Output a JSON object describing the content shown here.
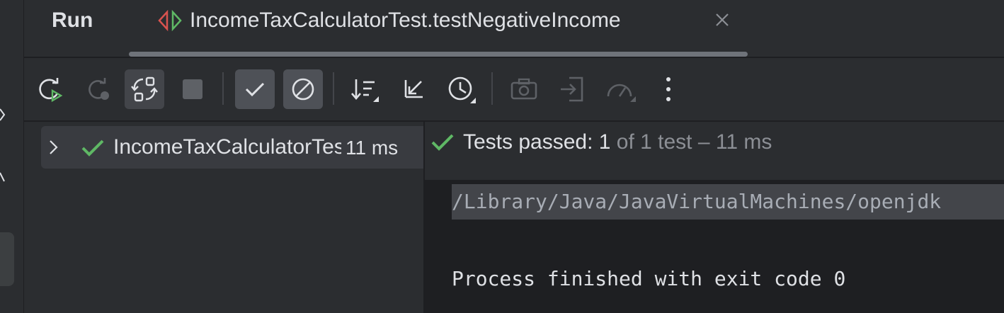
{
  "header": {
    "tool_window_title": "Run",
    "tab": {
      "title": "IncomeTaxCalculatorTest.testNegativeIncome",
      "icon": "test-run-icon"
    }
  },
  "toolbar": {
    "buttons": [
      {
        "name": "rerun-button",
        "icon": "rerun-icon",
        "enabled": true
      },
      {
        "name": "rerun-failed-button",
        "icon": "rerun-failed-icon",
        "enabled": false
      },
      {
        "name": "toggle-auto-test-button",
        "icon": "auto-test-icon",
        "enabled": true,
        "active": true
      },
      {
        "name": "stop-button",
        "icon": "stop-icon",
        "enabled": false
      },
      {
        "name": "show-passed-button",
        "icon": "check-icon",
        "enabled": true,
        "pressed": true
      },
      {
        "name": "show-ignored-button",
        "icon": "ignored-icon",
        "enabled": true,
        "pressed": true
      },
      {
        "name": "sort-button",
        "icon": "sort-icon",
        "enabled": true
      },
      {
        "name": "collapse-button",
        "icon": "collapse-icon",
        "enabled": true
      },
      {
        "name": "test-history-button",
        "icon": "history-icon",
        "enabled": true
      },
      {
        "name": "screenshot-button",
        "icon": "camera-icon",
        "enabled": false
      },
      {
        "name": "import-tests-button",
        "icon": "import-icon",
        "enabled": false
      },
      {
        "name": "coverage-button",
        "icon": "gauge-icon",
        "enabled": false
      },
      {
        "name": "more-button",
        "icon": "more-vertical-icon",
        "enabled": true
      }
    ]
  },
  "tree": {
    "rows": [
      {
        "label": "IncomeTaxCalculatorTest",
        "duration": "11 ms",
        "status": "passed"
      }
    ]
  },
  "status": {
    "main": "Tests passed: 1",
    "sub": " of 1 test – 11 ms"
  },
  "console": {
    "lines": [
      "/Library/Java/JavaVirtualMachines/openjdk",
      "Process finished with exit code 0"
    ]
  },
  "colors": {
    "background": "#2b2d30",
    "console_background": "#1e1f22",
    "success_green": "#5fb865",
    "selection": "#393b40"
  }
}
